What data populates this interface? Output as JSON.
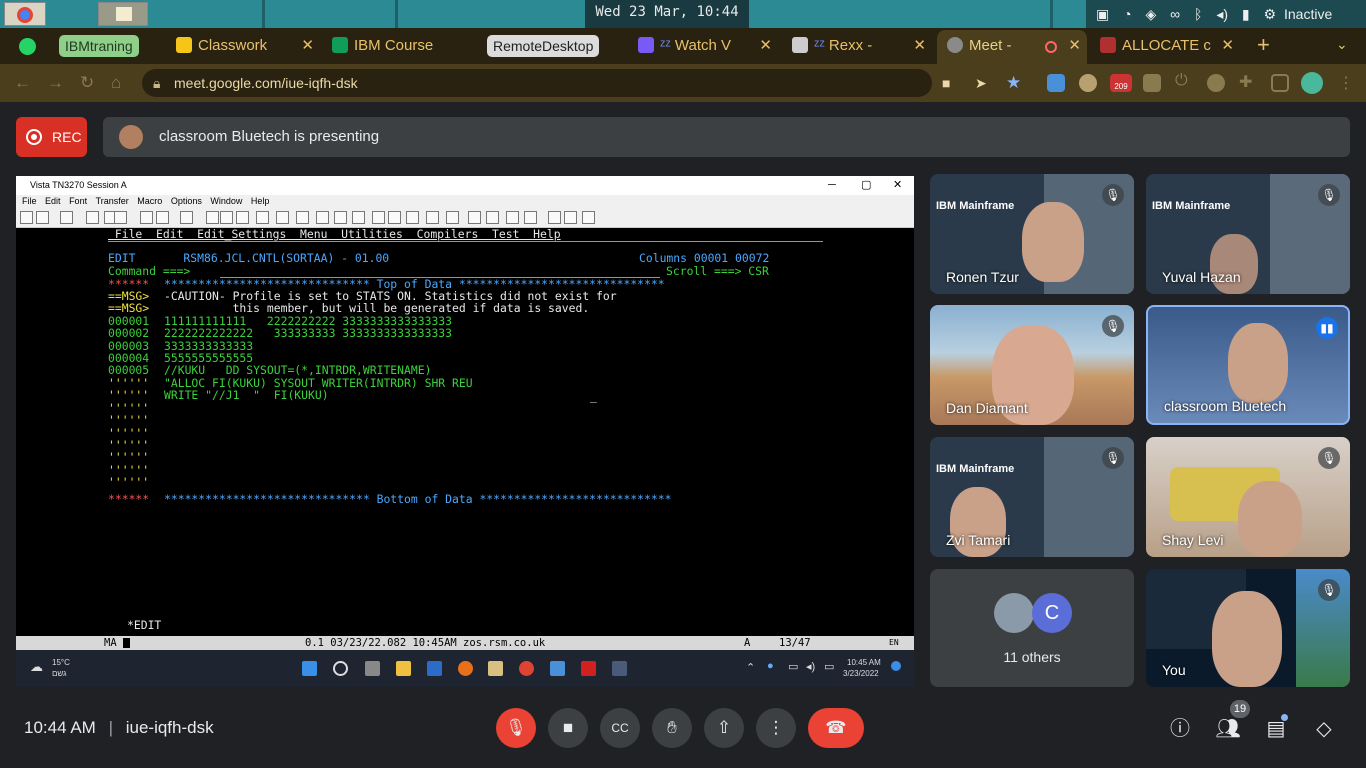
{
  "system": {
    "clock": "Wed 23 Mar, 10:44",
    "status": "Inactive"
  },
  "tabs": [
    {
      "label": "IBMtraning"
    },
    {
      "label": "Classwork"
    },
    {
      "label": "IBM Course"
    },
    {
      "label": "RemoteDesktop"
    },
    {
      "label": "Watch V"
    },
    {
      "label": "Rexx  -"
    },
    {
      "label": "Meet  -"
    },
    {
      "label": "ALLOCATE c"
    }
  ],
  "address": {
    "url": "meet.google.com/iue-iqfh-dsk",
    "ext_badge": "209"
  },
  "meet": {
    "rec_label": "REC",
    "presenting": "classroom Bluetech is presenting",
    "others_label": "11 others",
    "others_initial": "C",
    "time": "10:44 AM",
    "code": "iue-iqfh-dsk",
    "people_count": "19"
  },
  "participants": [
    {
      "name": "Ronen Tzur"
    },
    {
      "name": "Yuval Hazan"
    },
    {
      "name": "Dan Diamant"
    },
    {
      "name": "classroom Bluetech"
    },
    {
      "name": "Zvi Tamari"
    },
    {
      "name": "Shay Levi"
    },
    {
      "name": "You"
    }
  ],
  "tile_text": {
    "ibm": "IBM Mainframe"
  },
  "vista": {
    "title": "Vista TN3270 Session A",
    "menu": [
      "File",
      "Edit",
      "Font",
      "Transfer",
      "Macro",
      "Options",
      "Window",
      "Help"
    ],
    "status_bar": {
      "left": "MA",
      "mid": "0.1 03/23/22.082 10:45AM zos.rsm.co.uk",
      "right1": "A",
      "right2": "13/47",
      "lang": "EN"
    },
    "taskbar": {
      "temp": "15°C",
      "weather": "גשם",
      "time": "10:45 AM",
      "date": "3/23/2022"
    }
  },
  "terminal": {
    "menubar": " File  Edit  Edit_Settings  Menu  Utilities  Compilers  Test  Help",
    "edit_head": "EDIT       RSM86.JCL.CNTL(SORTAA) - 01.00",
    "columns": "Columns 00001 00072",
    "command": "Command ===>",
    "scroll": "Scroll ===> CSR",
    "top": "****************************** Top of Data ******************************",
    "stars": "******",
    "msg_tag": "==MSG>",
    "msg1": "-CAUTION- Profile is set to STATS ON. Statistics did not exist for",
    "msg2": "          this member, but will be generated if data is saved.",
    "lines": [
      {
        "num": "000001",
        "text": "111111111111   2222222222 3333333333333333"
      },
      {
        "num": "000002",
        "text": "2222222222222   333333333 3333333333333333"
      },
      {
        "num": "000003",
        "text": "3333333333333"
      },
      {
        "num": "000004",
        "text": "5555555555555"
      },
      {
        "num": "000005",
        "text": "//KUKU   DD SYSOUT=(*,INTRDR,WRITENAME)"
      },
      {
        "num": "''''''",
        "text": "\"ALLOC FI(KUKU) SYSOUT WRITER(INTRDR) SHR REU"
      },
      {
        "num": "''''''",
        "text": "WRITE \"//J1  \"  FI(KUKU)"
      }
    ],
    "empty": "''''''",
    "bottom": "****************************** Bottom of Data ****************************",
    "mode": "*EDIT"
  }
}
